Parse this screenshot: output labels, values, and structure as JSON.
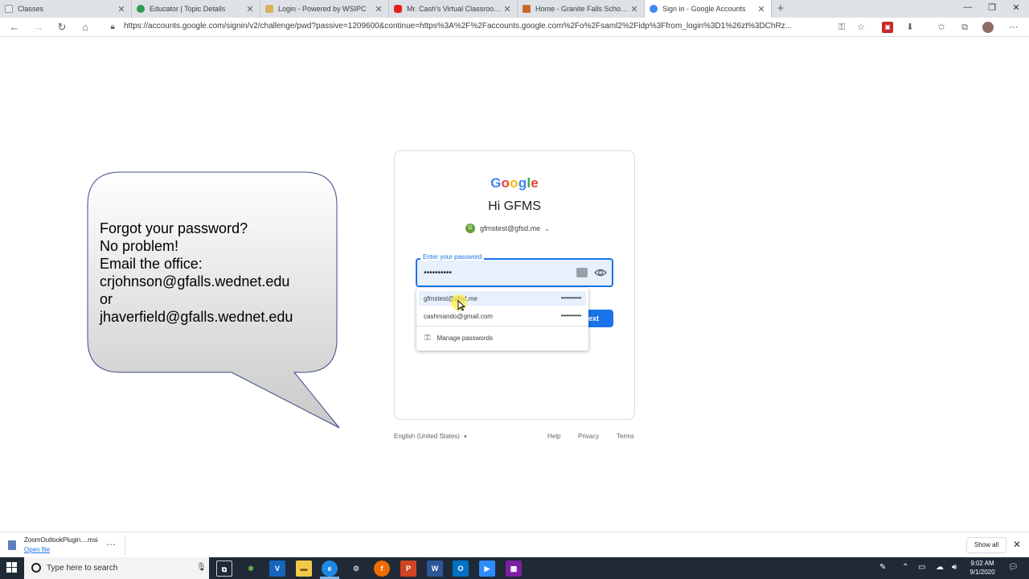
{
  "browser": {
    "tabs": [
      {
        "title": "Classes",
        "active": false,
        "favicon_color": "#eeeeee"
      },
      {
        "title": "Educator | Topic Details",
        "active": false,
        "favicon_color": "#2e9e4f"
      },
      {
        "title": "Login - Powered by WSIPC",
        "active": false,
        "favicon_color": "#d6b35a"
      },
      {
        "title": "Mr. Cash's Virtual Classroom - Yo",
        "active": false,
        "favicon_color": "#e62117"
      },
      {
        "title": "Home - Granite Falls School Dist",
        "active": false,
        "favicon_color": "#c66a2c"
      },
      {
        "title": "Sign in - Google Accounts",
        "active": true,
        "favicon_color": "#4285f4"
      }
    ],
    "url": "https://accounts.google.com/signin/v2/challenge/pwd?passive=1209600&continue=https%3A%2F%2Faccounts.google.com%2Fo%2Fsaml2%2Fidp%3Ffrom_login%3D1%26zt%3DChRz..."
  },
  "callout": {
    "lines": [
      "Forgot your password?",
      "No problem!",
      "Email the office:",
      "crjohnson@gfalls.wednet.edu",
      "or",
      "jhaverfield@gfalls.wednet.edu"
    ]
  },
  "signin": {
    "logo": "Google",
    "greeting": "Hi GFMS",
    "account": {
      "initial": "G",
      "email": "gfmstest@gfsd.me"
    },
    "password_label": "Enter your password",
    "password_value": "••••••••••",
    "next_label": "Next"
  },
  "autofill": {
    "entries": [
      {
        "email": "gfmstest@gfsd.me",
        "masked": "•••••••••••",
        "highlighted": true
      },
      {
        "email": "cashmando@gmail.com",
        "masked": "•••••••••••",
        "highlighted": false
      }
    ],
    "manage_label": "Manage passwords"
  },
  "footer": {
    "language": "English (United States)",
    "links": [
      "Help",
      "Privacy",
      "Terms"
    ]
  },
  "downloads": {
    "file_name": "ZoomOutlookPlugin....msi",
    "open_label": "Open file",
    "show_all_label": "Show all"
  },
  "taskbar": {
    "search_placeholder": "Type here to search",
    "time": "9:02 AM",
    "date": "9/1/2020"
  }
}
